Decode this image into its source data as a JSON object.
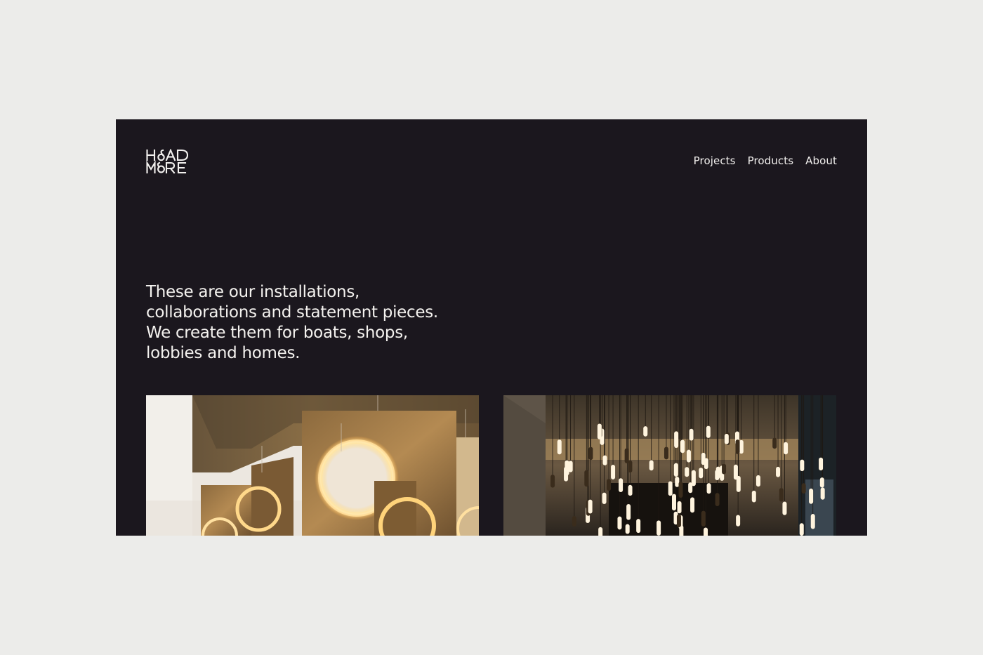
{
  "brand": {
    "logo_top": "HOAD",
    "logo_bottom": "MORE"
  },
  "nav": {
    "items": [
      {
        "label": "Projects"
      },
      {
        "label": "Products"
      },
      {
        "label": "About"
      }
    ]
  },
  "intro": {
    "lines": [
      "These are our installations,",
      "collaborations and statement pieces.",
      "We create them for boats, shops,",
      "lobbies and homes."
    ]
  },
  "colors": {
    "page_background": "#ececea",
    "panel_background": "#1b171e",
    "text": "#f2f0ee"
  },
  "projects": [
    {
      "image": "bronze-ring-light-installation"
    },
    {
      "image": "pendant-tube-light-installation"
    }
  ]
}
